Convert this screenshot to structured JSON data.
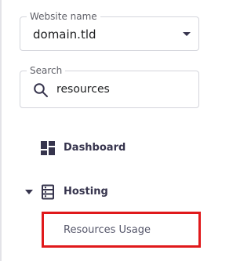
{
  "website_field": {
    "label": "Website name",
    "value": "domain.tld"
  },
  "search_field": {
    "label": "Search",
    "value": "resources",
    "icon": "search-icon"
  },
  "nav": {
    "dashboard": {
      "label": "Dashboard",
      "icon": "dashboard-icon"
    },
    "hosting": {
      "label": "Hosting",
      "icon": "server-icon",
      "expanded": true,
      "subitems": [
        {
          "label": "Resources Usage",
          "highlighted": true
        }
      ]
    }
  },
  "colors": {
    "highlight": "#e0191b",
    "nav_text": "#36344d"
  }
}
